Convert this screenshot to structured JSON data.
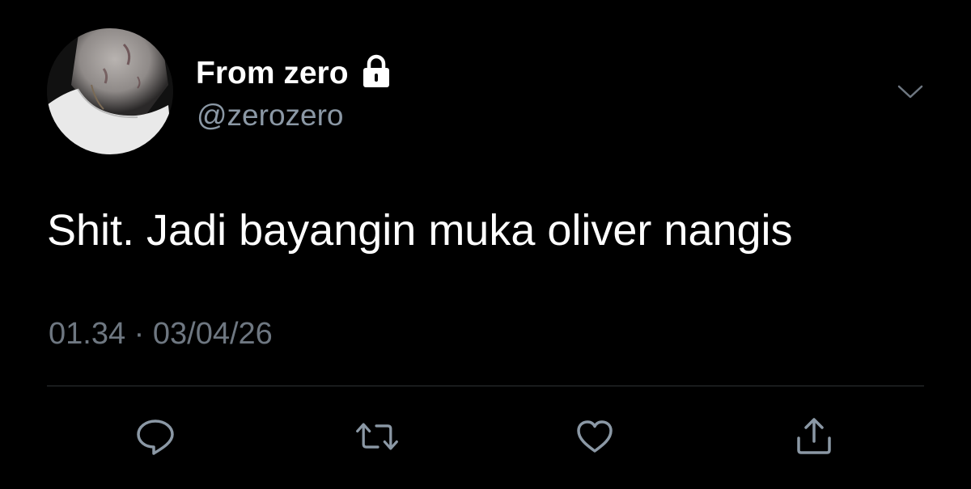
{
  "user": {
    "display_name": "From zero",
    "handle": "@zerozero",
    "protected": true
  },
  "tweet": {
    "text": "Shit. Jadi bayangin muka oliver nangis",
    "timestamp": "01.34 · 03/04/26"
  },
  "icons": {
    "avatar": "profile-photo",
    "lock": "lock-icon",
    "menu": "chevron-down-icon",
    "reply": "reply-icon",
    "retweet": "retweet-icon",
    "like": "heart-icon",
    "share": "share-icon"
  },
  "colors": {
    "background": "#000000",
    "primary_text": "#ffffff",
    "secondary_text": "#8b98a5",
    "timestamp_text": "#6e7781",
    "icon": "#8b98a5",
    "divider": "#2f3336"
  }
}
